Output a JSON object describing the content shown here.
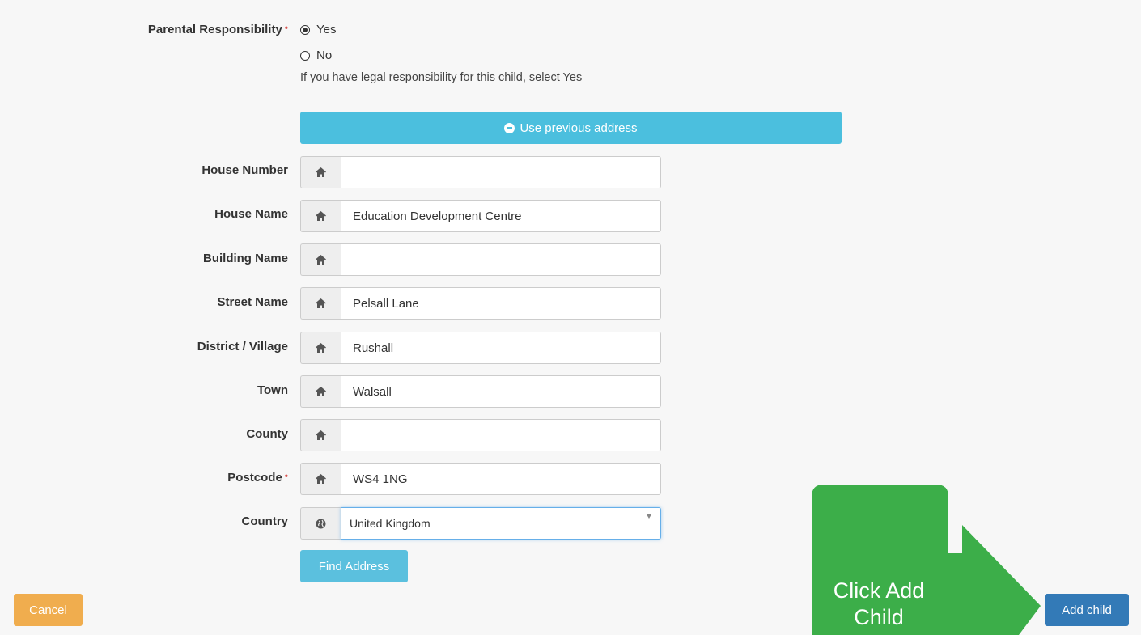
{
  "parental": {
    "label": "Parental Responsibility",
    "required_mark": "•",
    "options": [
      {
        "label": "Yes",
        "checked": true
      },
      {
        "label": "No",
        "checked": false
      }
    ],
    "help": "If you have legal responsibility for this child, select Yes"
  },
  "use_previous_label": "Use previous address",
  "fields": [
    {
      "label": "House Number",
      "value": "",
      "icon": "home-icon"
    },
    {
      "label": "House Name",
      "value": "Education Development Centre",
      "icon": "home-icon"
    },
    {
      "label": "Building Name",
      "value": "",
      "icon": "home-icon"
    },
    {
      "label": "Street Name",
      "value": "Pelsall Lane",
      "icon": "home-icon"
    },
    {
      "label": "District / Village",
      "value": "Rushall",
      "icon": "home-icon"
    },
    {
      "label": "Town",
      "value": "Walsall",
      "icon": "home-icon"
    },
    {
      "label": "County",
      "value": "",
      "icon": "home-icon"
    },
    {
      "label": "Postcode",
      "value": "WS4 1NG",
      "icon": "home-icon",
      "required_mark": "•"
    }
  ],
  "country": {
    "label": "Country",
    "value": "United Kingdom",
    "icon": "globe-icon"
  },
  "find_address_label": "Find Address",
  "cancel_label": "Cancel",
  "add_child_label": "Add child",
  "callout_text": "Click Add\nChild",
  "colors": {
    "info": "#4bbfde",
    "warning": "#f0ad4e",
    "primary": "#337ab7",
    "callout": "#3cae49",
    "required": "#d9534f"
  }
}
